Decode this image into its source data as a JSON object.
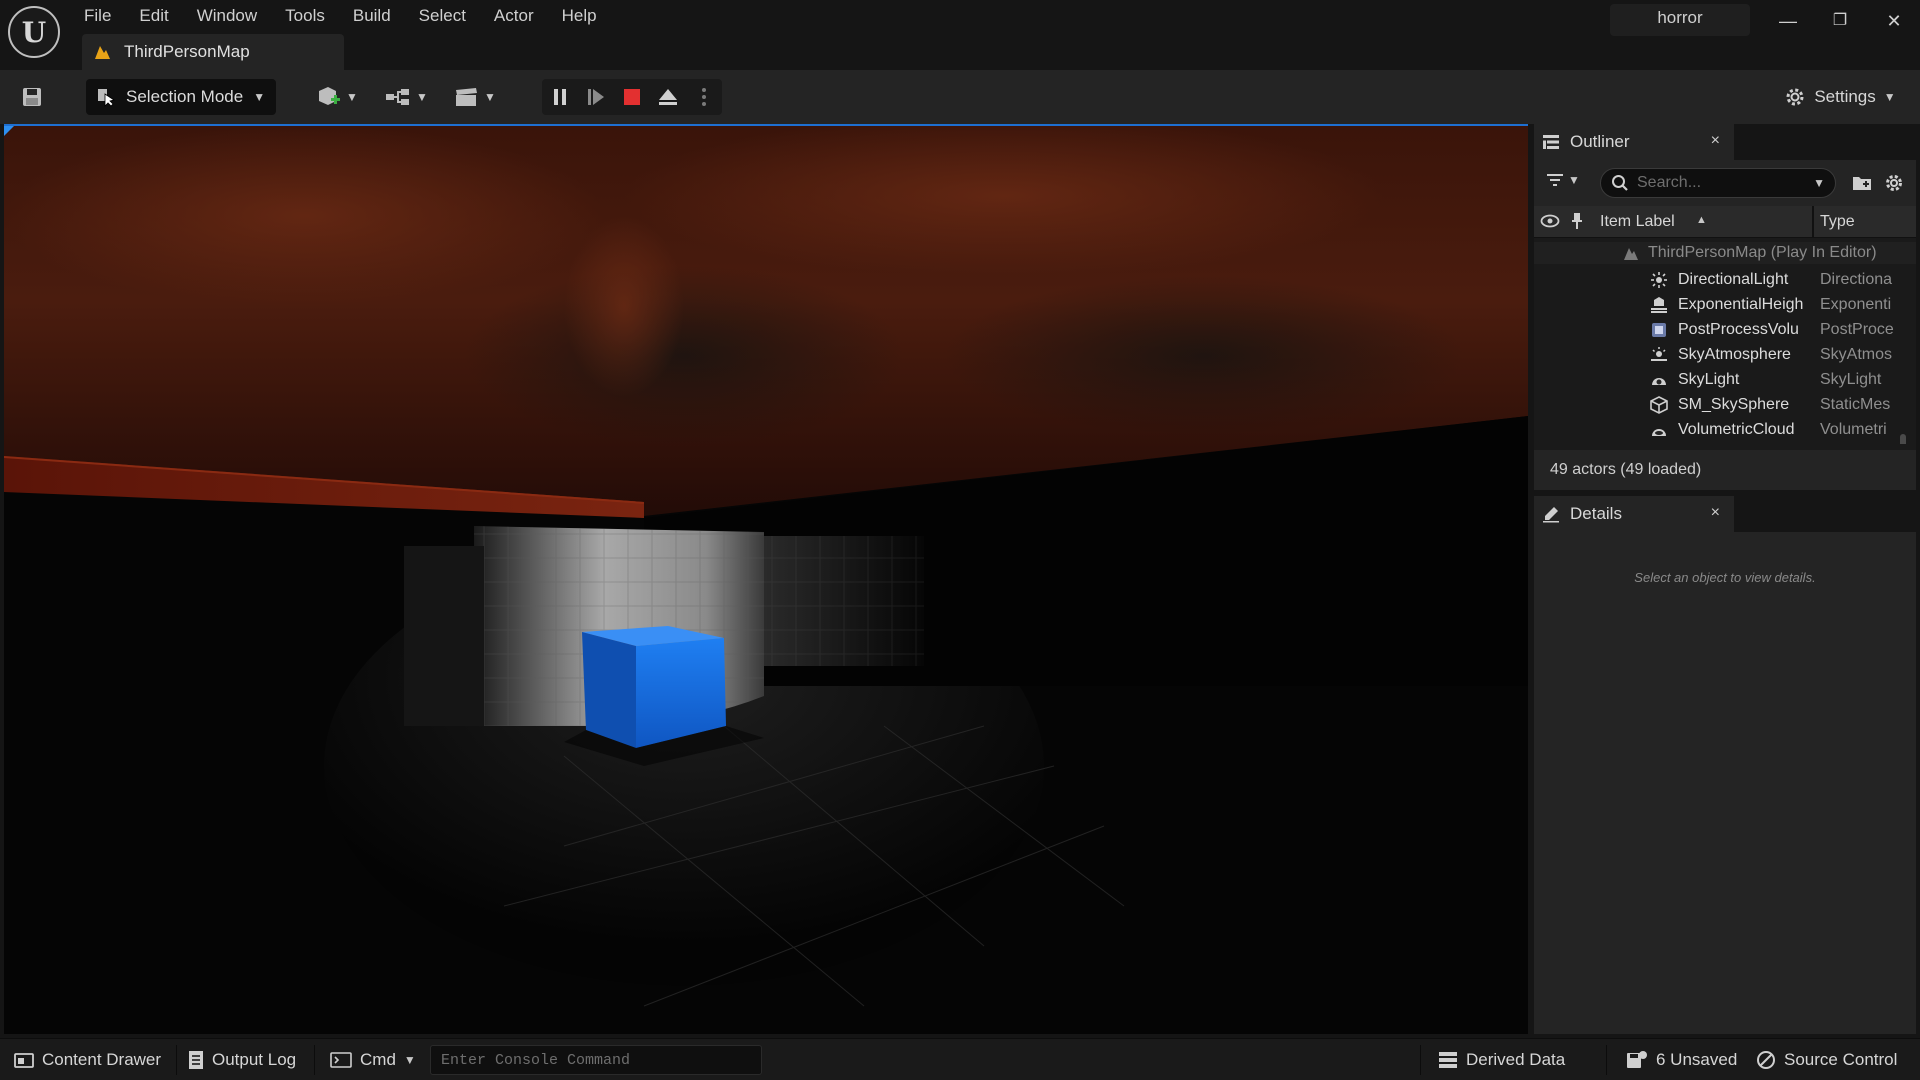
{
  "app": {
    "logo_text": "U",
    "project_name": "horror"
  },
  "menu": [
    "File",
    "Edit",
    "Window",
    "Tools",
    "Build",
    "Select",
    "Actor",
    "Help"
  ],
  "tab": {
    "label": "ThirdPersonMap"
  },
  "window_controls": {
    "minimize": "—",
    "restore": "❐",
    "close": "✕"
  },
  "toolbar": {
    "selection_mode": "Selection Mode",
    "settings": "Settings"
  },
  "outliner": {
    "title": "Outliner",
    "close": "×",
    "search_placeholder": "Search...",
    "columns": {
      "label": "Item Label",
      "sort_indicator": "▲",
      "type": "Type"
    },
    "root": "ThirdPersonMap (Play In Editor)",
    "items": [
      {
        "label": "DirectionalLight",
        "type": "Directiona",
        "icon": "directional-light-icon"
      },
      {
        "label": "ExponentialHeigh",
        "type": "Exponenti",
        "icon": "fog-icon"
      },
      {
        "label": "PostProcessVolu",
        "type": "PostProce",
        "icon": "post-process-icon"
      },
      {
        "label": "SkyAtmosphere",
        "type": "SkyAtmos",
        "icon": "sky-atmosphere-icon"
      },
      {
        "label": "SkyLight",
        "type": "SkyLight",
        "icon": "sky-light-icon"
      },
      {
        "label": "SM_SkySphere",
        "type": "StaticMes",
        "icon": "static-mesh-icon"
      },
      {
        "label": "VolumetricCloud",
        "type": "Volumetri",
        "icon": "volumetric-cloud-icon"
      }
    ],
    "actor_count": "49 actors (49 loaded)"
  },
  "details": {
    "title": "Details",
    "close": "×",
    "hint": "Select an object to view details."
  },
  "statusbar": {
    "content_drawer": "Content Drawer",
    "output_log": "Output Log",
    "cmd": "Cmd",
    "console_placeholder": "Enter Console Command",
    "derived_data": "Derived Data",
    "unsaved": "6 Unsaved",
    "source_control": "Source Control"
  },
  "colors": {
    "accent_blue": "#1e6fd1",
    "stop_red": "#e33030",
    "warning_orange": "#e8a317",
    "cube_blue": "#1a72e6"
  }
}
